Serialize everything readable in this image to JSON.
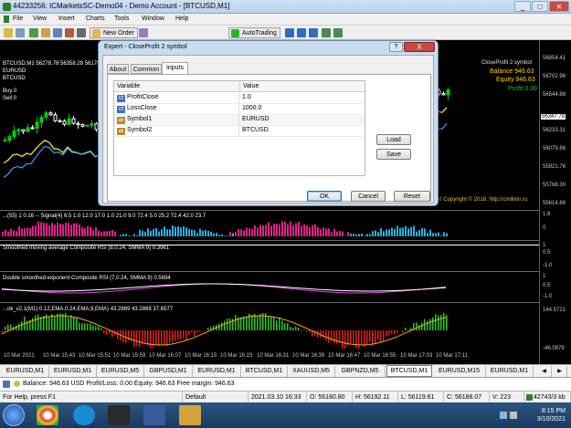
{
  "window": {
    "title": "44233256: ICMarketsSC-Demo04 - Demo Account - [BTCUSD,M1]"
  },
  "menu": [
    "File",
    "View",
    "Insert",
    "Charts",
    "Tools",
    "Window",
    "Help"
  ],
  "toolbar": {
    "new_order": "New Order",
    "autotrading": "AutoTrading"
  },
  "chart": {
    "header": "BTCUSD,M1  56278.78 56358.28 56178.45 56188.07",
    "symbol_a": "EURUSD",
    "symbol_b": "BTCUSD",
    "buy": "Buy 0",
    "sell": "Sell 0",
    "ea_name": "CloseProfit 2 symbol",
    "balance": "Balance 946.63",
    "equity": "Equity 946.63",
    "profit": "Profit 0.00",
    "copyright": "rt Copyright © 2018, http://cmillion.ru",
    "ind1_label": "...(55) 1 0.16 -- Signal(4) 6.5 1.0 12.0 17.0 1.0 21.0 9.0 72.4 5.0 25.2 72.4 42.0 23.7",
    "ind2_label": "Smoothed moving average Composite RSI (8,0.24, SMMA 9) 0.3961",
    "ind3_label": "Double smoothed exponent Composite RSI (7,0.24, SMMA 9) 0.5694",
    "ind4_label": "...ok_v2.1(M1) 0.12,EMA,0.24,EMA,9,EMA) 43.2869 43.2869 37.6577",
    "price_labels": [
      "56854.41",
      "56702.96",
      "56544.86",
      "56347.78",
      "56233.31",
      "56079.86",
      "55921.76",
      "55768.30",
      "55614.86"
    ],
    "price_tag": "56347.78",
    "ind_scale": [
      "1.8",
      "1",
      "0",
      "-1.0",
      "1",
      "0.5",
      "0",
      "-1.0",
      "1",
      "0.5",
      "0",
      "-1.0",
      "144.5721",
      "-46.0979"
    ],
    "time_labels": [
      "10 Mar 2021",
      "10 Mar 15:43",
      "10 Mar 15:51",
      "10 Mar 15:59",
      "10 Mar 16:07",
      "10 Mar 16:15",
      "10 Mar 16:23",
      "10 Mar 16:31",
      "10 Mar 16:39",
      "10 Mar 16:47",
      "10 Mar 16:55",
      "10 Mar 17:03",
      "10 Mar 17:11"
    ]
  },
  "dialog": {
    "title": "Expert - CloseProfit 2 symbol",
    "help": "?",
    "close": "X",
    "tabs": [
      "About",
      "Common",
      "Inputs"
    ],
    "active_tab": "Inputs",
    "col_variable": "Variable",
    "col_value": "Value",
    "rows": [
      {
        "icon": "V2",
        "name": "ProfitClose",
        "value": "1.0"
      },
      {
        "icon": "V2",
        "name": "LossClose",
        "value": "1000.0"
      },
      {
        "icon": "ab",
        "name": "Symbol1",
        "value": "EURUSD"
      },
      {
        "icon": "ab",
        "name": "Symbol2",
        "value": "BTCUSD"
      }
    ],
    "load": "Load",
    "save": "Save",
    "ok": "OK",
    "cancel": "Cancel",
    "reset": "Reset"
  },
  "tabs": [
    "EURUSD,M1",
    "EURUSD,M1",
    "EURUSD,M5",
    "GBPUSD,M1",
    "EURUSD,M1",
    "BTCUSD,M1",
    "XAUUSD,M5",
    "GBPNZD,M5",
    "BTCUSD,M1",
    "EURUSD,M15",
    "EURUSD,M1"
  ],
  "active_tab_index": 8,
  "account": {
    "line": "Balance: 946.63 USD  Profit/Loss: 0.00  Equity: 946.63  Free margin: 946.63"
  },
  "status": {
    "help": "For Help, press F1",
    "profile": "Default",
    "time": "2021.03.10 16:33",
    "open": "O: 56180.80",
    "high": "H: 56192.11",
    "low": "L: 56119.61",
    "close": "C: 56188.07",
    "volume": "V: 223",
    "traffic": "42743/3 kb"
  },
  "clock": {
    "time": "8:15 PM",
    "date": "3/10/2021"
  },
  "colors": {
    "bull": "#00d000",
    "bear": "#ffffff",
    "accent": "#1e6fd8"
  }
}
